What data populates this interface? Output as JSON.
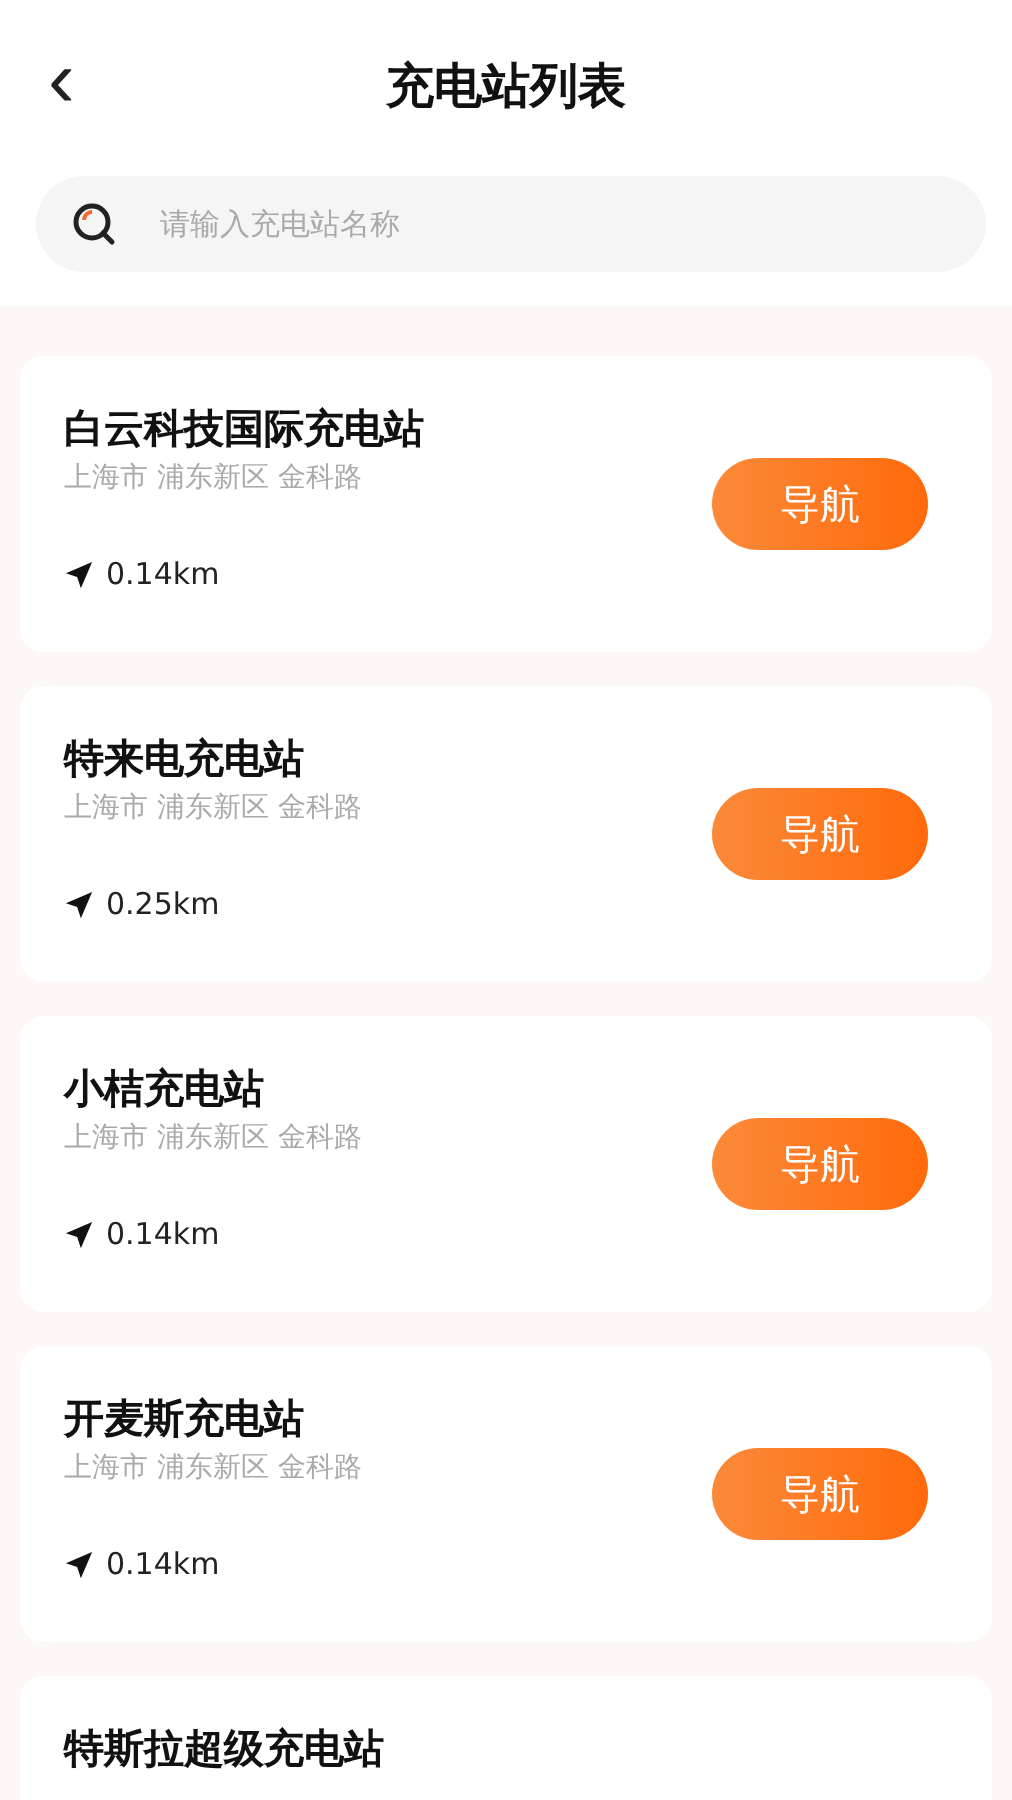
{
  "header": {
    "back": "‹",
    "title": "充电站列表"
  },
  "search": {
    "placeholder": "请输入充电站名称"
  },
  "stations": [
    {
      "name": "白云科技国际充电站",
      "address": "上海市 浦东新区 金科路",
      "distance": "0.14km",
      "nav": "导航"
    },
    {
      "name": "特来电充电站",
      "address": "上海市 浦东新区 金科路",
      "distance": "0.25km",
      "nav": "导航"
    },
    {
      "name": "小桔充电站",
      "address": "上海市 浦东新区 金科路",
      "distance": "0.14km",
      "nav": "导航"
    },
    {
      "name": "开麦斯充电站",
      "address": "上海市 浦东新区 金科路",
      "distance": "0.14km",
      "nav": "导航"
    },
    {
      "name": "特斯拉超级充电站"
    }
  ]
}
